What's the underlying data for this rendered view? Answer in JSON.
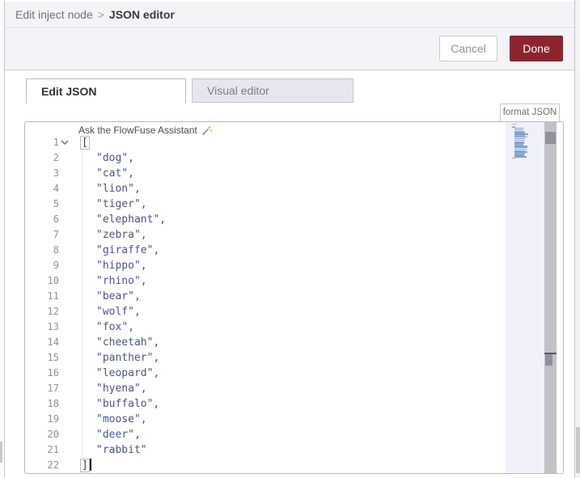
{
  "breadcrumb": {
    "parent": "Edit inject node",
    "separator": ">",
    "current": "JSON editor"
  },
  "actions": {
    "cancel": "Cancel",
    "done": "Done"
  },
  "tabs": [
    {
      "label": "Edit JSON",
      "active": true
    },
    {
      "label": "Visual editor",
      "active": false
    }
  ],
  "toolbar": {
    "format_button": "format JSON"
  },
  "editor": {
    "assistant_hint": "Ask the FlowFuse Assistant",
    "language": "json",
    "lines": [
      {
        "num": "1",
        "kind": "open",
        "content": "[",
        "fold": true
      },
      {
        "num": "2",
        "kind": "string",
        "value": "dog",
        "comma": true
      },
      {
        "num": "3",
        "kind": "string",
        "value": "cat",
        "comma": true
      },
      {
        "num": "4",
        "kind": "string",
        "value": "lion",
        "comma": true
      },
      {
        "num": "5",
        "kind": "string",
        "value": "tiger",
        "comma": true
      },
      {
        "num": "6",
        "kind": "string",
        "value": "elephant",
        "comma": true
      },
      {
        "num": "7",
        "kind": "string",
        "value": "zebra",
        "comma": true
      },
      {
        "num": "8",
        "kind": "string",
        "value": "giraffe",
        "comma": true
      },
      {
        "num": "9",
        "kind": "string",
        "value": "hippo",
        "comma": true
      },
      {
        "num": "10",
        "kind": "string",
        "value": "rhino",
        "comma": true
      },
      {
        "num": "11",
        "kind": "string",
        "value": "bear",
        "comma": true
      },
      {
        "num": "12",
        "kind": "string",
        "value": "wolf",
        "comma": true
      },
      {
        "num": "13",
        "kind": "string",
        "value": "fox",
        "comma": true
      },
      {
        "num": "14",
        "kind": "string",
        "value": "cheetah",
        "comma": true
      },
      {
        "num": "15",
        "kind": "string",
        "value": "panther",
        "comma": true
      },
      {
        "num": "16",
        "kind": "string",
        "value": "leopard",
        "comma": true
      },
      {
        "num": "17",
        "kind": "string",
        "value": "hyena",
        "comma": true
      },
      {
        "num": "18",
        "kind": "string",
        "value": "buffalo",
        "comma": true
      },
      {
        "num": "19",
        "kind": "string",
        "value": "moose",
        "comma": true
      },
      {
        "num": "20",
        "kind": "string",
        "value": "deer",
        "comma": true
      },
      {
        "num": "21",
        "kind": "string",
        "value": "rabbit",
        "comma": false
      },
      {
        "num": "22",
        "kind": "close",
        "content": "]",
        "cursor": true
      }
    ]
  },
  "icons": {
    "assistant": "magic-wand-icon",
    "fold": "chevron-down-icon"
  },
  "colors": {
    "done_button": "#8e2430",
    "header_bg": "#f3f3f8",
    "inactive_tab_bg": "#e6e6f0",
    "string_token": "#4a5494",
    "minimap_mark": "#7fa3d2",
    "scrollbar_track": "#c1c2c8"
  }
}
